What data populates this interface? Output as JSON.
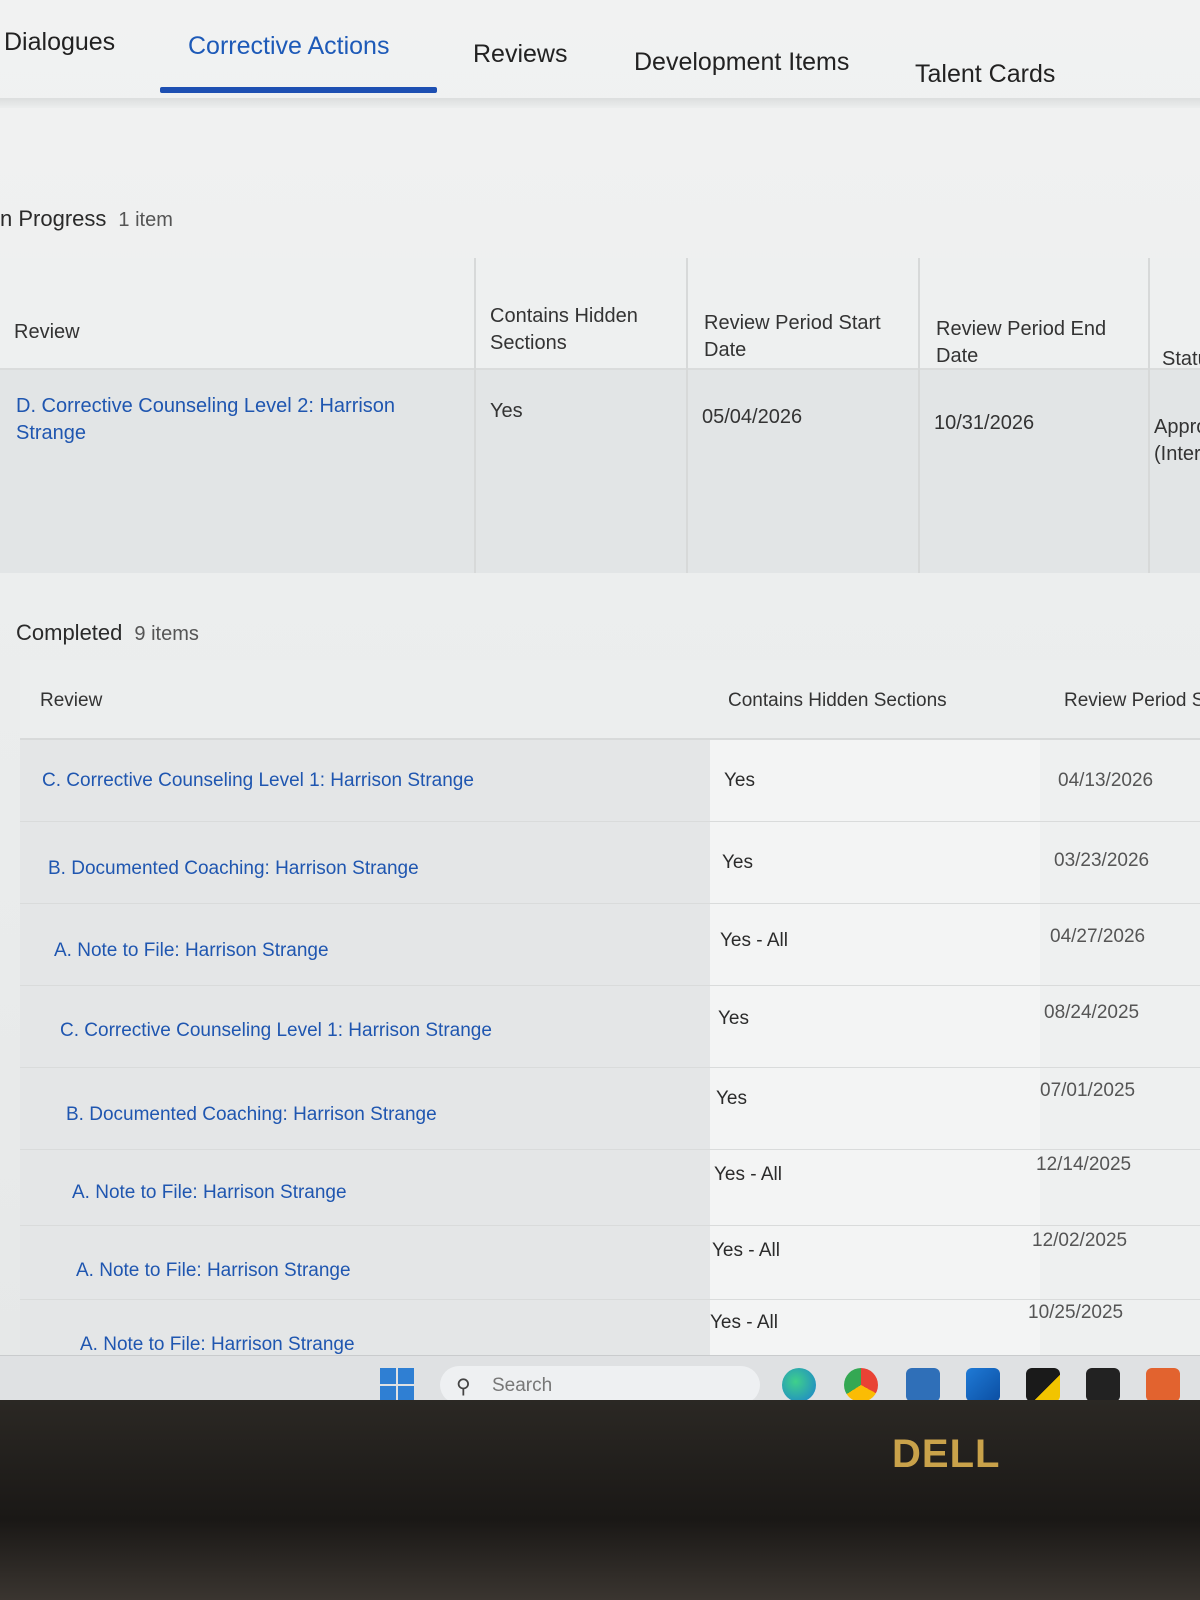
{
  "tabs": [
    {
      "label": "Dialogues"
    },
    {
      "label": "Corrective Actions",
      "active": true
    },
    {
      "label": "Reviews"
    },
    {
      "label": "Development Items"
    },
    {
      "label": "Talent Cards"
    }
  ],
  "in_progress": {
    "heading": "n Progress",
    "count": "1 item",
    "columns": [
      "Review",
      "Contains Hidden Sections",
      "Review Period Start Date",
      "Review Period End Date",
      "Statu"
    ],
    "rows": [
      {
        "review": "D. Corrective Counseling Level 2: Harrison Strange",
        "hidden": "Yes",
        "start": "05/04/2026",
        "end": "10/31/2026",
        "status": "Appro (Inter"
      }
    ]
  },
  "completed": {
    "heading": "Completed",
    "count": "9 items",
    "columns": [
      "Review",
      "Contains Hidden Sections",
      "Review Period St"
    ],
    "rows": [
      {
        "review": "C. Corrective Counseling Level 1: Harrison Strange",
        "hidden": "Yes",
        "start": "04/13/2026"
      },
      {
        "review": "B. Documented Coaching: Harrison Strange",
        "hidden": "Yes",
        "start": "03/23/2026"
      },
      {
        "review": "A. Note to File: Harrison Strange",
        "hidden": "Yes - All",
        "start": "04/27/2026"
      },
      {
        "review": "C. Corrective Counseling Level 1: Harrison Strange",
        "hidden": "Yes",
        "start": "08/24/2025"
      },
      {
        "review": "B. Documented Coaching: Harrison Strange",
        "hidden": "Yes",
        "start": "07/01/2025"
      },
      {
        "review": "A. Note to File: Harrison Strange",
        "hidden": "Yes - All",
        "start": "12/14/2025"
      },
      {
        "review": "A. Note to File: Harrison Strange",
        "hidden": "Yes - All",
        "start": "12/02/2025"
      },
      {
        "review": "A. Note to File: Harrison Strange",
        "hidden": "Yes - All",
        "start": "10/25/2025"
      }
    ]
  },
  "taskbar": {
    "search_placeholder": "Search",
    "apps": [
      "edge-icon",
      "chrome-icon",
      "snipping-tool-icon",
      "outlook-icon",
      "sticky-notes-icon",
      "app-icon",
      "office-icon"
    ]
  },
  "monitor": {
    "brand": "DELL"
  },
  "colors": {
    "link": "#1f56b0",
    "tab_active": "#1d5ab8",
    "underline": "#1d4fb2"
  }
}
